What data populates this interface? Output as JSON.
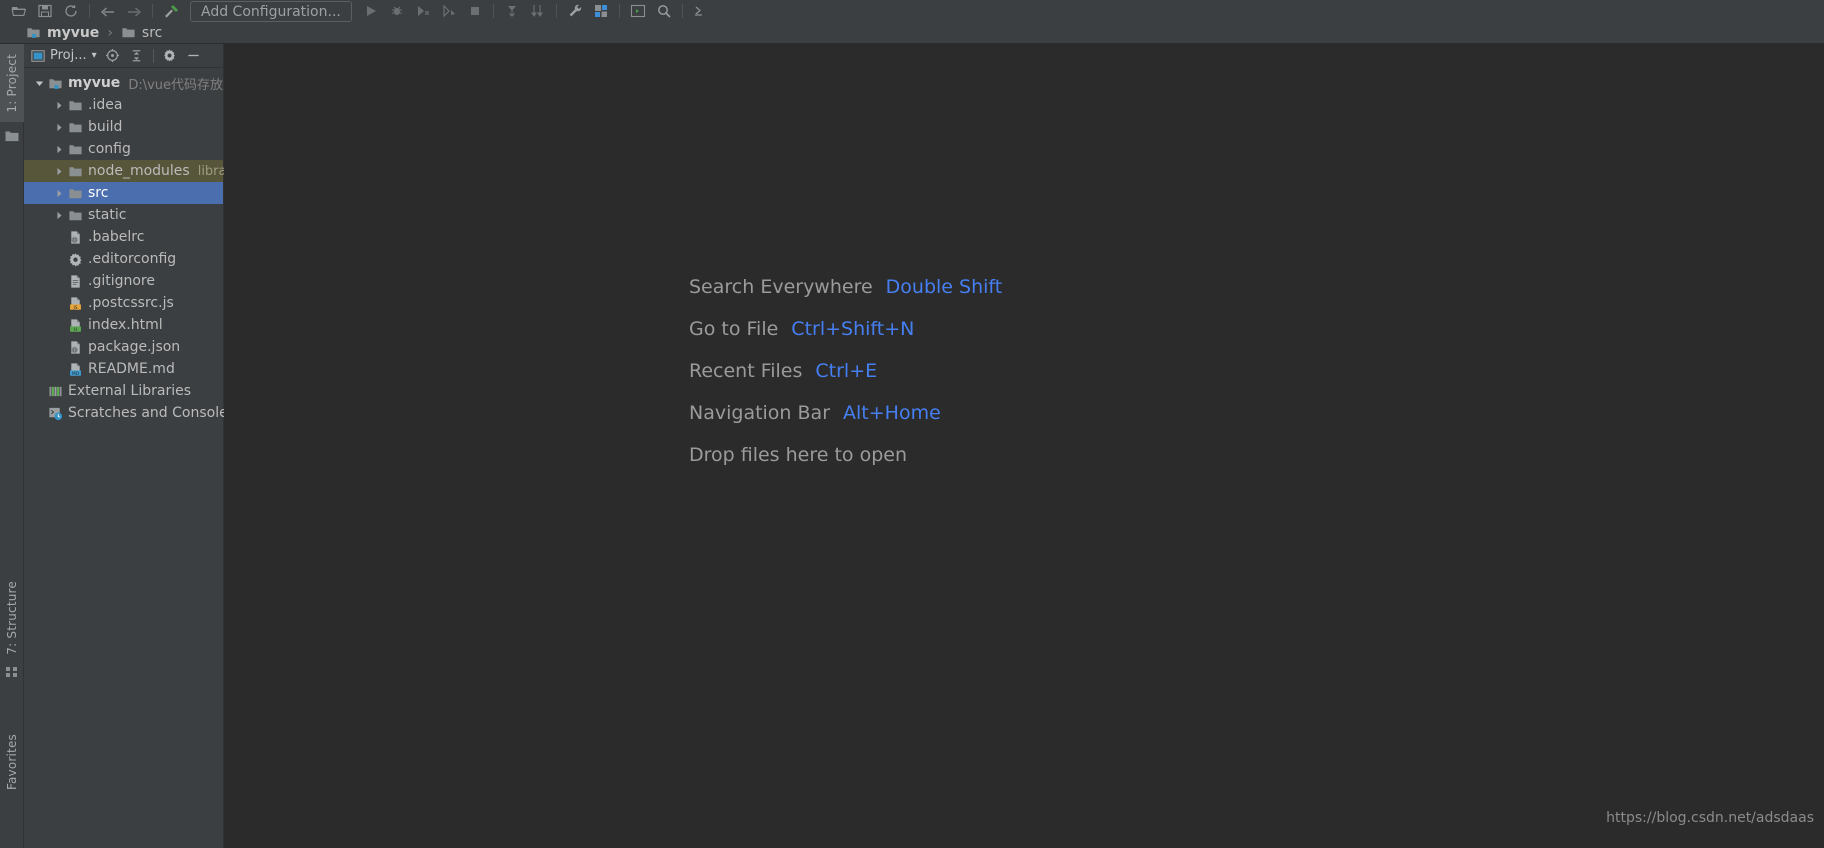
{
  "toolbar": {
    "icons": [
      {
        "name": "open-folder-icon"
      },
      {
        "name": "save-all-icon"
      },
      {
        "name": "sync-refresh-icon"
      },
      {
        "name": "separator"
      },
      {
        "name": "undo-arrow-icon"
      },
      {
        "name": "redo-arrow-icon"
      },
      {
        "name": "separator"
      },
      {
        "name": "build-hammer-icon"
      }
    ],
    "run_configuration": "Add Configuration...",
    "right_icons": [
      {
        "name": "run-icon"
      },
      {
        "name": "debug-icon"
      },
      {
        "name": "run-with-coverage-icon"
      },
      {
        "name": "profile-icon"
      },
      {
        "name": "stop-icon"
      },
      {
        "name": "separator"
      },
      {
        "name": "update-project-icon"
      },
      {
        "name": "commit-icon"
      },
      {
        "name": "separator"
      },
      {
        "name": "wrench-icon"
      },
      {
        "name": "project-structure-icon"
      },
      {
        "name": "separator"
      },
      {
        "name": "run-anything-icon"
      },
      {
        "name": "search-everywhere-icon"
      },
      {
        "name": "separator"
      },
      {
        "name": "terminal-icon"
      }
    ]
  },
  "breadcrumb": {
    "items": [
      {
        "label": "myvue",
        "icon": "module-folder-icon",
        "bold": true
      },
      {
        "label": "src",
        "icon": "folder-icon",
        "bold": false
      }
    ],
    "separator": "›"
  },
  "left_tool_strip": {
    "top_tabs": [
      {
        "label": "1: Project",
        "active": true,
        "icon": "project-folder-icon"
      }
    ],
    "bottom_tabs": [
      {
        "label": "7: Structure",
        "icon": "structure-icon"
      },
      {
        "label": "Favorites",
        "icon": "favorites-icon"
      }
    ]
  },
  "project_panel": {
    "title": "Proj...",
    "title_dropdown": "▾",
    "buttons": [
      {
        "name": "select-opened-file-icon",
        "tooltip": "Select Opened File"
      },
      {
        "name": "collapse-all-icon",
        "tooltip": "Collapse All"
      },
      {
        "name": "settings-gear-icon",
        "tooltip": "Settings"
      },
      {
        "name": "hide-panel-icon",
        "tooltip": "Hide"
      }
    ],
    "tree": [
      {
        "label": "myvue",
        "sub": "D:\\vue代码存放处",
        "icon": "module-folder-icon",
        "indent": 0,
        "arrow": "expanded",
        "bold": true,
        "state": "normal"
      },
      {
        "label": ".idea",
        "sub": "",
        "icon": "folder-icon",
        "indent": 1,
        "arrow": "collapsed",
        "bold": false,
        "state": "normal"
      },
      {
        "label": "build",
        "sub": "",
        "icon": "folder-icon",
        "indent": 1,
        "arrow": "collapsed",
        "bold": false,
        "state": "normal"
      },
      {
        "label": "config",
        "sub": "",
        "icon": "folder-icon",
        "indent": 1,
        "arrow": "collapsed",
        "bold": false,
        "state": "normal"
      },
      {
        "label": "node_modules",
        "sub": "library",
        "icon": "folder-icon",
        "indent": 1,
        "arrow": "collapsed",
        "bold": false,
        "state": "library"
      },
      {
        "label": "src",
        "sub": "",
        "icon": "folder-icon",
        "indent": 1,
        "arrow": "collapsed",
        "bold": false,
        "state": "selected"
      },
      {
        "label": "static",
        "sub": "",
        "icon": "folder-icon",
        "indent": 1,
        "arrow": "collapsed",
        "bold": false,
        "state": "normal"
      },
      {
        "label": ".babelrc",
        "sub": "",
        "icon": "json-file-icon",
        "indent": 1,
        "arrow": "none",
        "bold": false,
        "state": "normal"
      },
      {
        "label": ".editorconfig",
        "sub": "",
        "icon": "gear-file-icon",
        "indent": 1,
        "arrow": "none",
        "bold": false,
        "state": "normal"
      },
      {
        "label": ".gitignore",
        "sub": "",
        "icon": "text-file-icon",
        "indent": 1,
        "arrow": "none",
        "bold": false,
        "state": "normal"
      },
      {
        "label": ".postcssrc.js",
        "sub": "",
        "icon": "js-file-icon",
        "indent": 1,
        "arrow": "none",
        "bold": false,
        "state": "normal"
      },
      {
        "label": "index.html",
        "sub": "",
        "icon": "html-file-icon",
        "indent": 1,
        "arrow": "none",
        "bold": false,
        "state": "normal"
      },
      {
        "label": "package.json",
        "sub": "",
        "icon": "json-file-icon",
        "indent": 1,
        "arrow": "none",
        "bold": false,
        "state": "normal"
      },
      {
        "label": "README.md",
        "sub": "",
        "icon": "md-file-icon",
        "indent": 1,
        "arrow": "none",
        "bold": false,
        "state": "normal"
      },
      {
        "label": "External Libraries",
        "sub": "",
        "icon": "external-libraries-icon",
        "indent": 0,
        "arrow": "none",
        "bold": false,
        "state": "normal"
      },
      {
        "label": "Scratches and Consoles",
        "sub": "",
        "icon": "scratches-icon",
        "indent": 0,
        "arrow": "none",
        "bold": false,
        "state": "normal"
      }
    ]
  },
  "editor": {
    "shortcuts": [
      {
        "name": "Search Everywhere",
        "key": "Double Shift"
      },
      {
        "name": "Go to File",
        "key": "Ctrl+Shift+N"
      },
      {
        "name": "Recent Files",
        "key": "Ctrl+E"
      },
      {
        "name": "Navigation Bar",
        "key": "Alt+Home"
      },
      {
        "name": "Drop files here to open",
        "key": ""
      }
    ],
    "watermark": "https://blog.csdn.net/adsdaas"
  },
  "colors": {
    "accent_blue": "#467ff2",
    "selection_blue": "#4b6eaf",
    "library_olive": "#57553a",
    "editor_bg": "#2b2b2b",
    "panel_bg": "#3c3f41"
  }
}
